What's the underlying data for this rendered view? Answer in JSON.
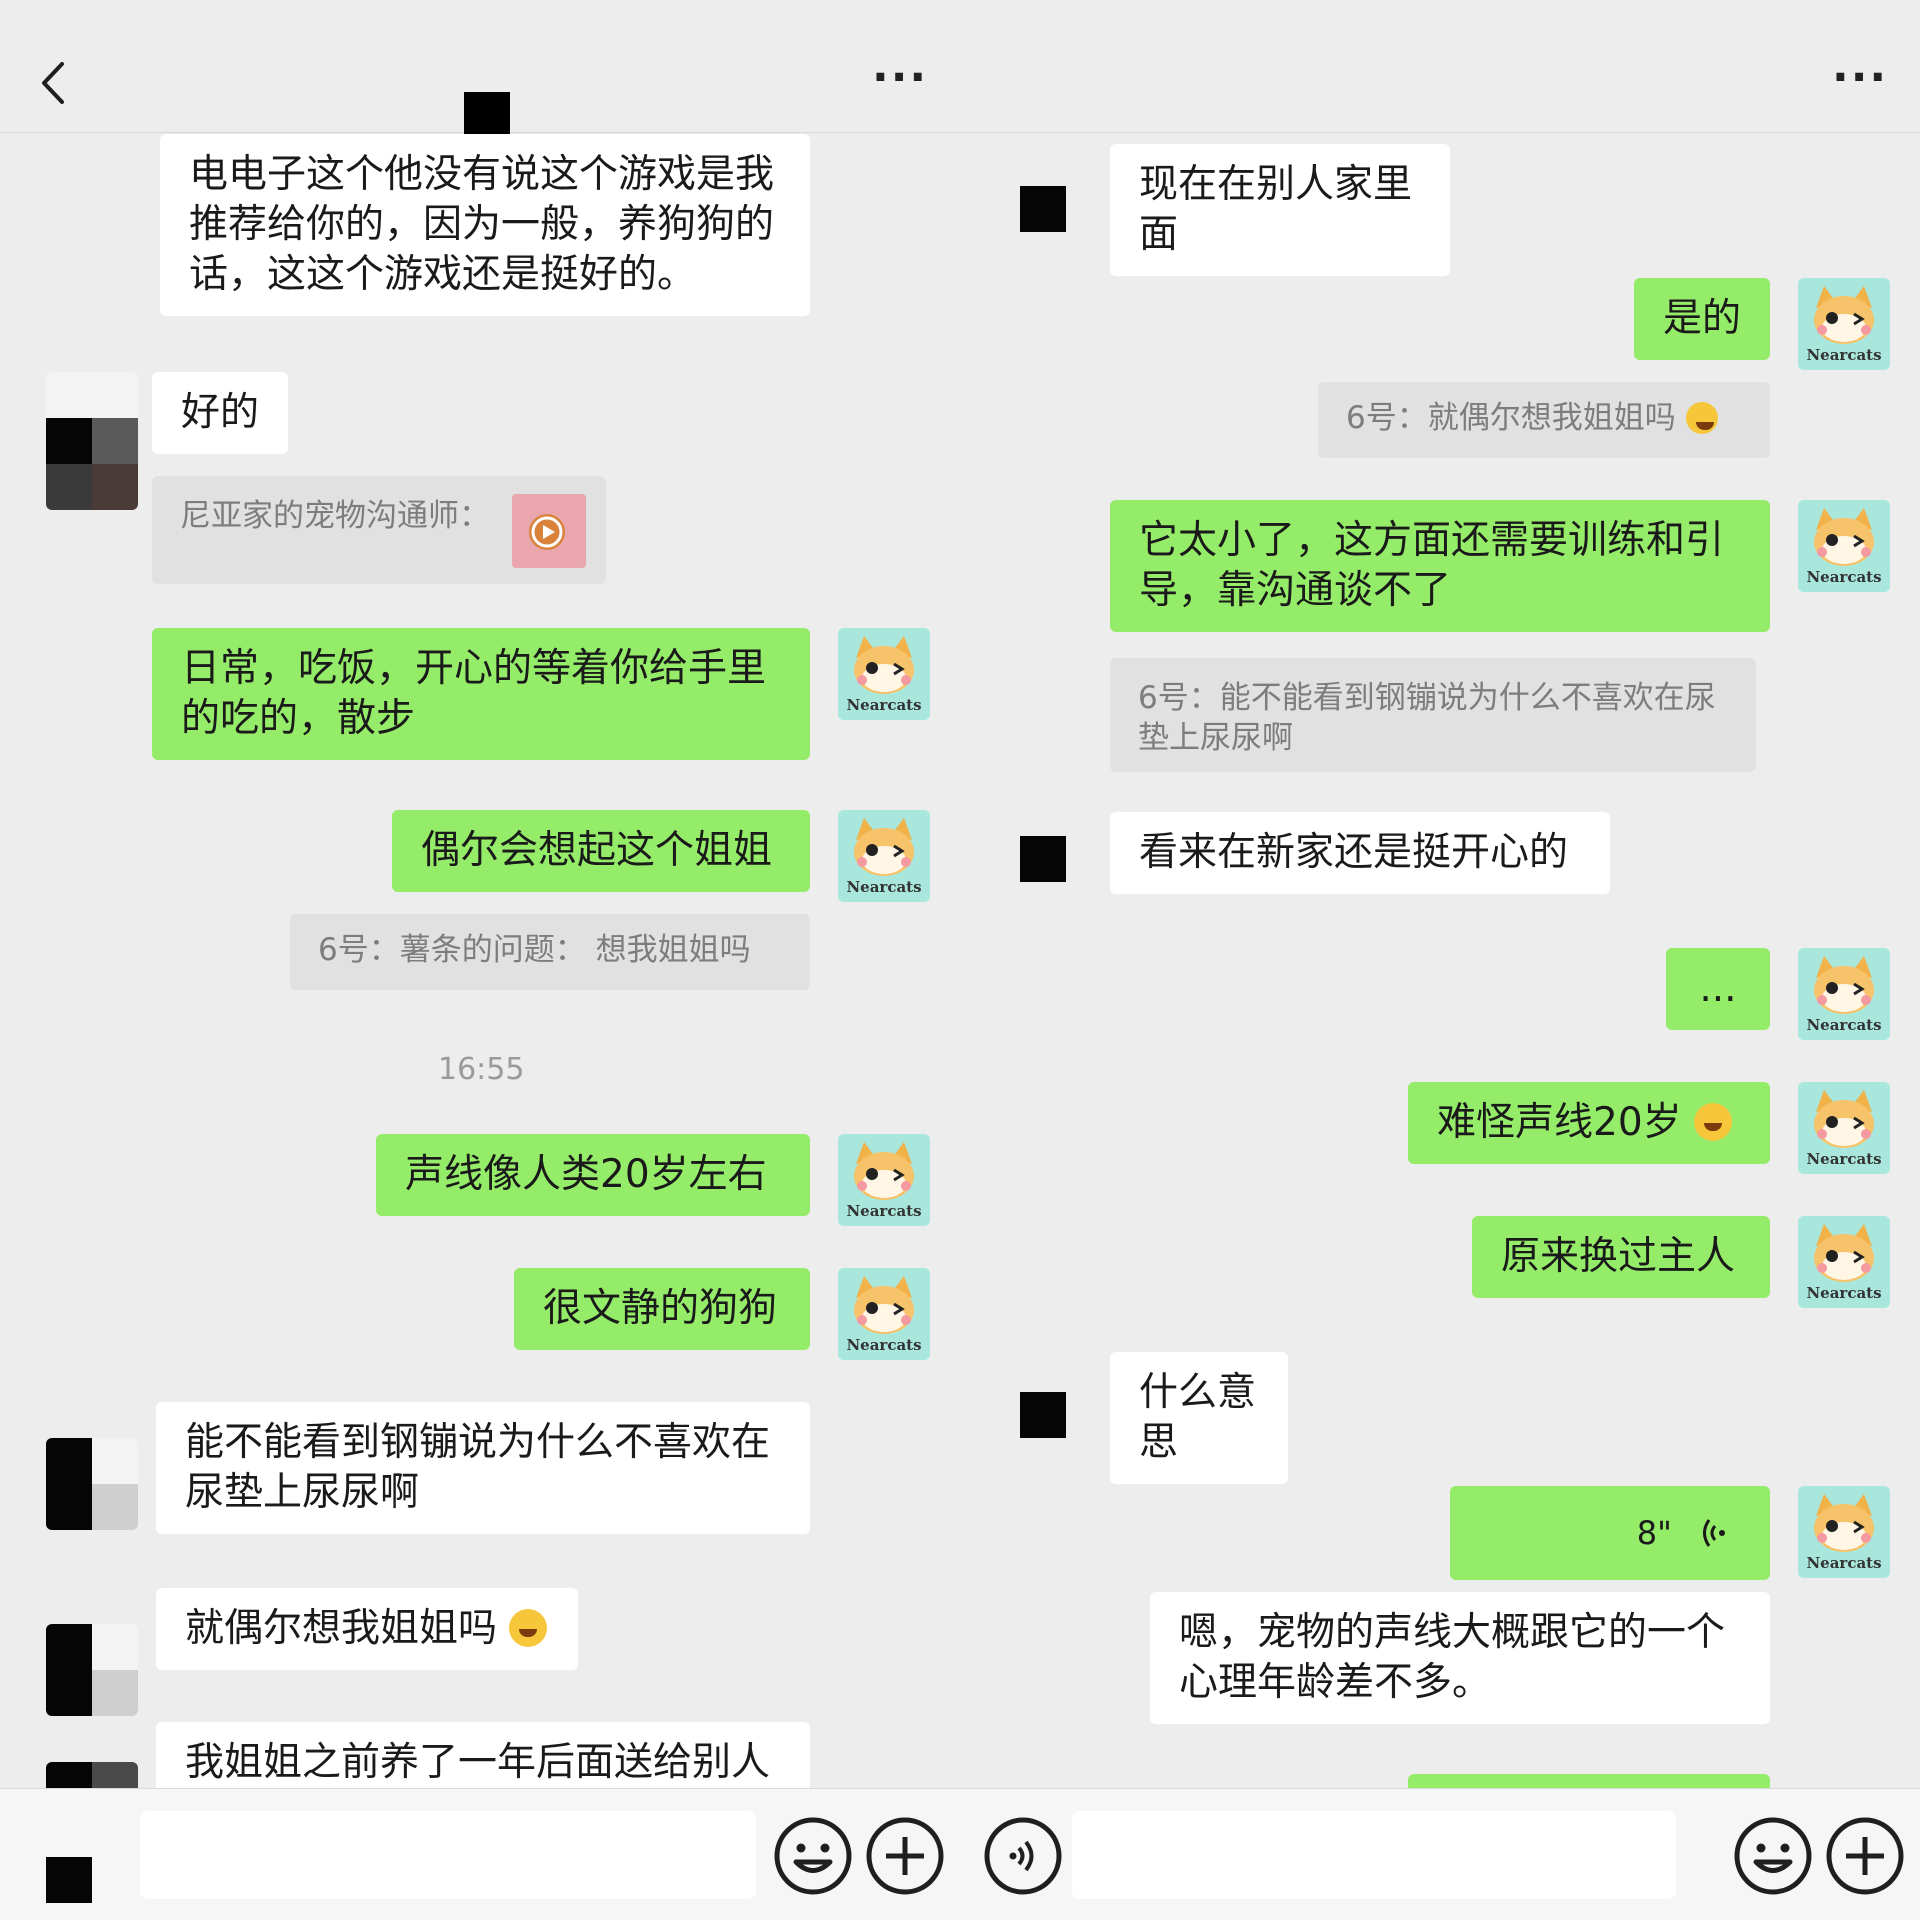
{
  "left": {
    "messages": {
      "m1": "电电子这个他没有说这个游戏是我推荐给你的，因为一般，养狗狗的话，这这个游戏还是挺好的。",
      "m2": "好的",
      "m3": "尼亚家的宠物沟通师：",
      "m4": "日常，吃饭，开心的等着你给手里的吃的，散步",
      "m5": "偶尔会想起这个姐姐",
      "m6": "6号：薯条的问题：  想我姐姐吗",
      "time": "16:55",
      "m7": "声线像人类20岁左右",
      "m8": "很文静的狗狗",
      "m9": "能不能看到钢镚说为什么不喜欢在尿垫上尿尿啊",
      "m10": "就偶尔想我姐姐吗",
      "m11": "我姐姐之前养了一年后面送给别人"
    }
  },
  "right": {
    "messages": {
      "r1": "现在在别人家里面",
      "r2": "是的",
      "r3": "6号：就偶尔想我姐姐吗",
      "r4": "它太小了，这方面还需要训练和引导，靠沟通谈不了",
      "r5": "6号：能不能看到钢镚说为什么不喜欢在尿垫上尿尿啊",
      "r6": "看来在新家还是挺开心的",
      "r7": "...",
      "r8": "难怪声线20岁",
      "r9": "原来换过主人",
      "r10": "什么意思",
      "r11": "8\"",
      "r12": "嗯，宠物的声线大概跟它的一个心理年龄差不多。"
    }
  },
  "avatar_label": "Nearcats",
  "colors": {
    "sent_bubble": "#95ec69",
    "received_bubble": "#ffffff",
    "quote_bg": "#e1e1e1",
    "background": "#ededed"
  }
}
